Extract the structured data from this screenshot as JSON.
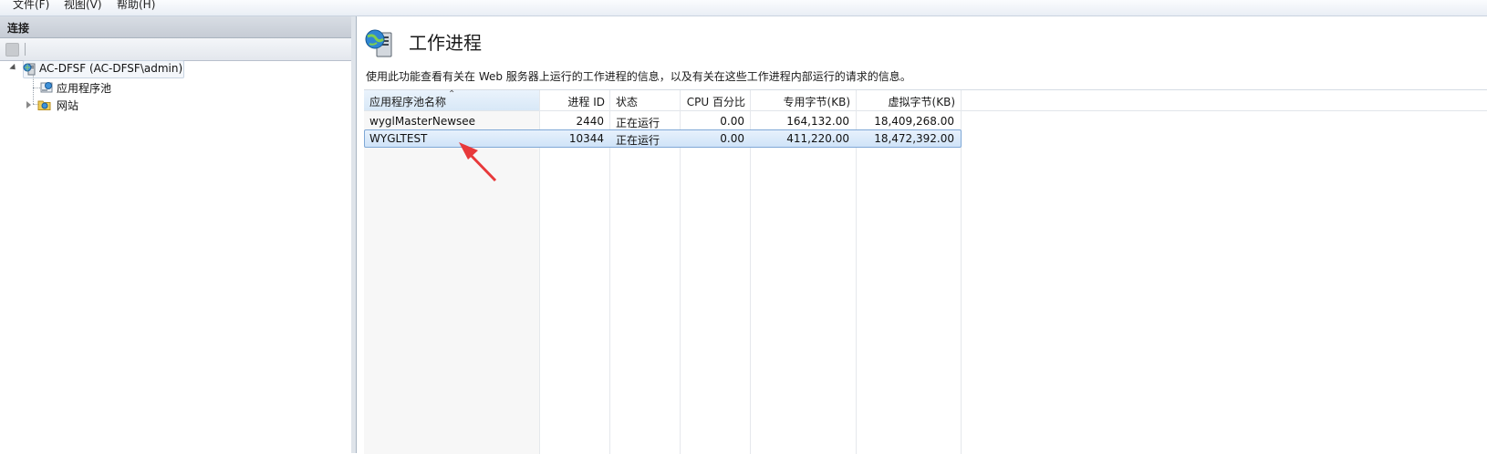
{
  "menu": {
    "items": [
      "文件(F)",
      "视图(V)",
      "帮助(H)"
    ]
  },
  "connections": {
    "title": "连接",
    "tree": [
      {
        "label": "AC-DFSF (AC-DFSF\\admin)",
        "icon": "server-icon"
      },
      {
        "label": "应用程序池",
        "icon": "app-pool-icon"
      },
      {
        "label": "网站",
        "icon": "sites-folder-icon"
      }
    ]
  },
  "main": {
    "title": "工作进程",
    "description": "使用此功能查看有关在 Web 服务器上运行的工作进程的信息，以及有关在这些工作进程内部运行的请求的信息。",
    "columns": [
      "应用程序池名称",
      "进程 ID",
      "状态",
      "CPU 百分比",
      "专用字节(KB)",
      "虚拟字节(KB)"
    ],
    "rows": [
      {
        "pool": "wyglMasterNewsee",
        "pid": "2440",
        "status": "正在运行",
        "cpu": "0.00",
        "private": "164,132.00",
        "virtual": "18,409,268.00"
      },
      {
        "pool": "WYGLTEST",
        "pid": "10344",
        "status": "正在运行",
        "cpu": "0.00",
        "private": "411,220.00",
        "virtual": "18,472,392.00"
      }
    ],
    "selected_row": 1
  },
  "colors": {
    "selection_border": "#7fa8d6",
    "selection_fill": "#d8e8f7",
    "annotation_arrow": "#e8393b"
  }
}
